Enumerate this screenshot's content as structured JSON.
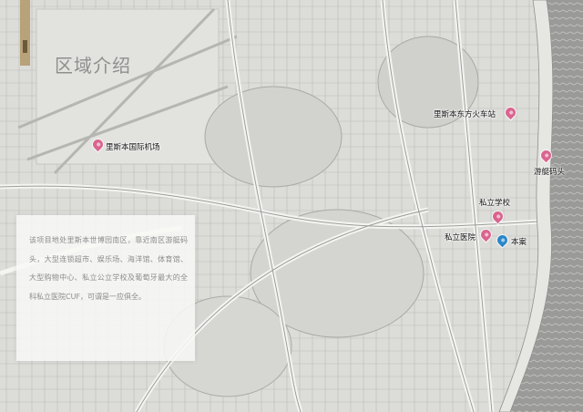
{
  "title": "区域介绍",
  "description": "该项目地处里斯本世博园南区，靠近南区游艇码头，大型连锁超市、娱乐场、海洋馆、体育馆、大型购物中心、私立公立学校及葡萄牙最大的全科私立医院CUF，可谓是一应俱全。",
  "colors": {
    "pin_pink": "#d9658f",
    "pin_blue": "#2a86c8",
    "accent": "#b8a27a",
    "water": "#8e8e8e"
  },
  "markers": [
    {
      "id": "airport",
      "label": "里斯本国际机场",
      "color": "pink"
    },
    {
      "id": "bus-station",
      "label": "里斯本东方火车站",
      "color": "pink"
    },
    {
      "id": "marina",
      "label": "游艇码头",
      "color": "pink"
    },
    {
      "id": "school",
      "label": "私立学校",
      "color": "pink"
    },
    {
      "id": "hospital",
      "label": "私立医院",
      "color": "pink"
    },
    {
      "id": "project",
      "label": "本案",
      "color": "blue"
    }
  ]
}
